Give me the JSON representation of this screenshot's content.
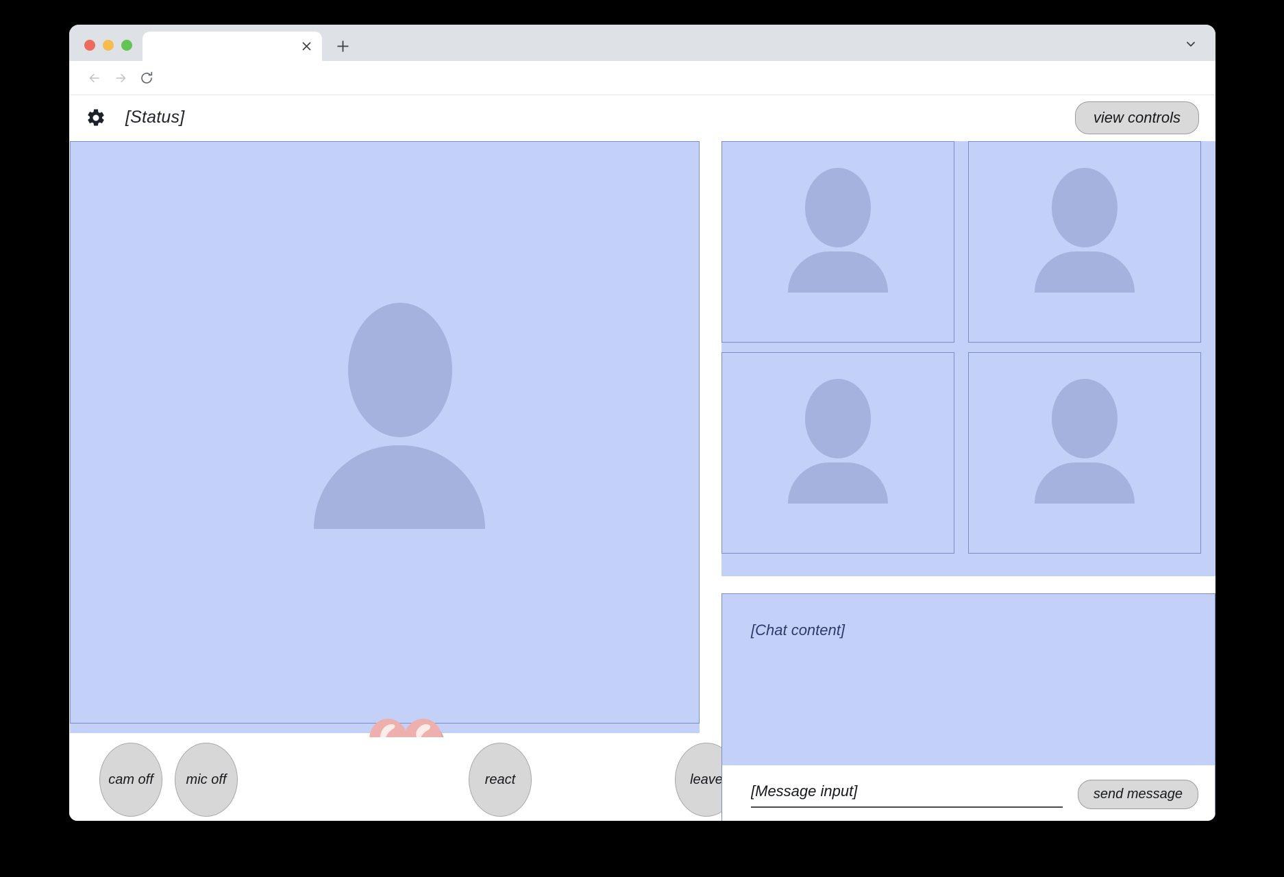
{
  "browser": {
    "tab_title": "",
    "close_icon": "close-icon",
    "new_tab_icon": "plus-icon",
    "tab_list_icon": "chevron-down-icon",
    "back_icon": "back-arrow-icon",
    "forward_icon": "forward-arrow-icon",
    "reload_icon": "reload-icon"
  },
  "header": {
    "settings_icon": "gear-icon",
    "status": "[Status]",
    "view_controls_label": "view controls"
  },
  "stage": {
    "avatar_icon": "person-avatar-icon",
    "reactions": [
      {
        "icon": "heart-icon"
      },
      {
        "icon": "heart-icon"
      }
    ]
  },
  "controls": [
    {
      "label": "cam off",
      "name": "cam-off-button"
    },
    {
      "label": "mic off",
      "name": "mic-off-button"
    },
    {
      "label": "react",
      "name": "react-button"
    },
    {
      "label": "leave",
      "name": "leave-button"
    }
  ],
  "participants": [
    {
      "avatar_icon": "person-avatar-icon"
    },
    {
      "avatar_icon": "person-avatar-icon"
    },
    {
      "avatar_icon": "person-avatar-icon"
    },
    {
      "avatar_icon": "person-avatar-icon"
    }
  ],
  "chat": {
    "content_label": "[Chat content]",
    "input_placeholder": "[Message input]",
    "input_value": "",
    "send_label": "send message"
  },
  "colors": {
    "panel_fill": "#c3d0f7",
    "panel_border": "#7b8cc4",
    "avatar_fill": "#a5b2dd",
    "button_fill": "#d9d9d9",
    "button_border": "#9b9b9b",
    "heart_fill": "#eeb0ac",
    "chat_text": "#2c3a6b"
  }
}
